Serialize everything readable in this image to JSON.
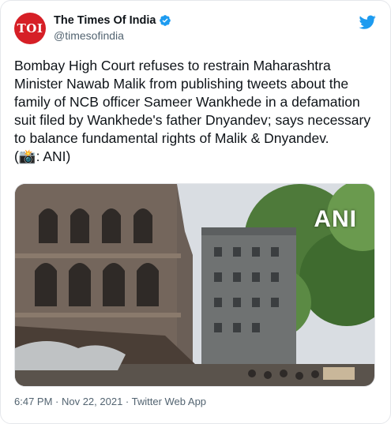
{
  "tweet": {
    "display_name": "The Times Of India",
    "handle": "@timesofindia",
    "avatar_text": "TOI",
    "text": "Bombay High Court refuses to restrain Maharashtra Minister Nawab Malik from publishing tweets about the family of NCB officer Sameer Wankhede in a defamation suit filed by Wankhede's father Dnyandev; says necessary to balance fundamental rights of Malik & Dnyandev.\n(📸: ANI)",
    "media_watermark": "ANI",
    "footer": "6:47 PM · Nov 22, 2021 · Twitter Web App"
  },
  "icons": {
    "verified": "verified-badge-icon",
    "twitter": "twitter-bird-icon"
  },
  "colors": {
    "avatar_bg": "#d61f26",
    "verified": "#1d9bf0",
    "text": "#0f1419",
    "secondary": "#536471"
  }
}
